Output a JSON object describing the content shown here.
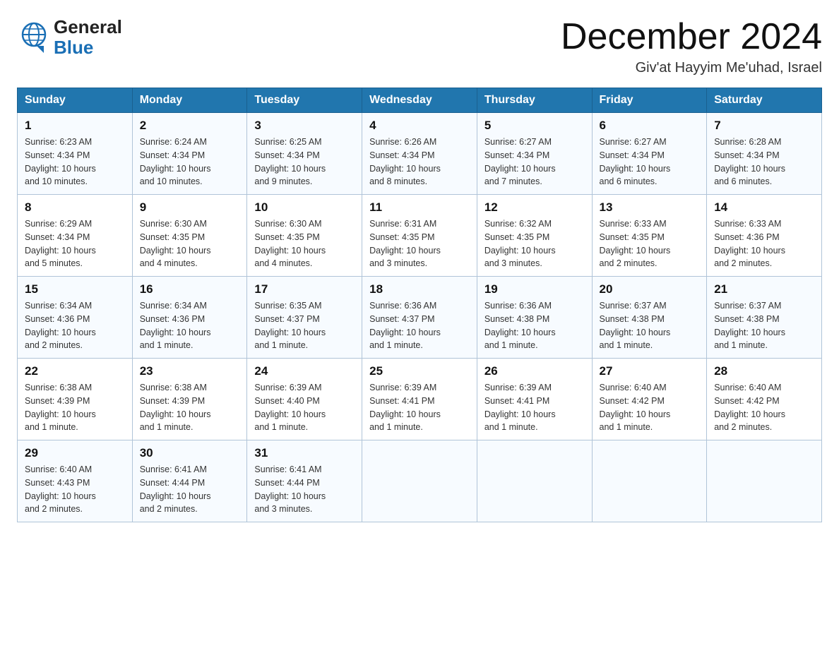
{
  "header": {
    "logo_general": "General",
    "logo_blue": "Blue",
    "month_title": "December 2024",
    "location": "Giv'at Hayyim Me'uhad, Israel"
  },
  "days_of_week": [
    "Sunday",
    "Monday",
    "Tuesday",
    "Wednesday",
    "Thursday",
    "Friday",
    "Saturday"
  ],
  "weeks": [
    [
      {
        "day": "1",
        "sunrise": "6:23 AM",
        "sunset": "4:34 PM",
        "daylight": "10 hours and 10 minutes."
      },
      {
        "day": "2",
        "sunrise": "6:24 AM",
        "sunset": "4:34 PM",
        "daylight": "10 hours and 10 minutes."
      },
      {
        "day": "3",
        "sunrise": "6:25 AM",
        "sunset": "4:34 PM",
        "daylight": "10 hours and 9 minutes."
      },
      {
        "day": "4",
        "sunrise": "6:26 AM",
        "sunset": "4:34 PM",
        "daylight": "10 hours and 8 minutes."
      },
      {
        "day": "5",
        "sunrise": "6:27 AM",
        "sunset": "4:34 PM",
        "daylight": "10 hours and 7 minutes."
      },
      {
        "day": "6",
        "sunrise": "6:27 AM",
        "sunset": "4:34 PM",
        "daylight": "10 hours and 6 minutes."
      },
      {
        "day": "7",
        "sunrise": "6:28 AM",
        "sunset": "4:34 PM",
        "daylight": "10 hours and 6 minutes."
      }
    ],
    [
      {
        "day": "8",
        "sunrise": "6:29 AM",
        "sunset": "4:34 PM",
        "daylight": "10 hours and 5 minutes."
      },
      {
        "day": "9",
        "sunrise": "6:30 AM",
        "sunset": "4:35 PM",
        "daylight": "10 hours and 4 minutes."
      },
      {
        "day": "10",
        "sunrise": "6:30 AM",
        "sunset": "4:35 PM",
        "daylight": "10 hours and 4 minutes."
      },
      {
        "day": "11",
        "sunrise": "6:31 AM",
        "sunset": "4:35 PM",
        "daylight": "10 hours and 3 minutes."
      },
      {
        "day": "12",
        "sunrise": "6:32 AM",
        "sunset": "4:35 PM",
        "daylight": "10 hours and 3 minutes."
      },
      {
        "day": "13",
        "sunrise": "6:33 AM",
        "sunset": "4:35 PM",
        "daylight": "10 hours and 2 minutes."
      },
      {
        "day": "14",
        "sunrise": "6:33 AM",
        "sunset": "4:36 PM",
        "daylight": "10 hours and 2 minutes."
      }
    ],
    [
      {
        "day": "15",
        "sunrise": "6:34 AM",
        "sunset": "4:36 PM",
        "daylight": "10 hours and 2 minutes."
      },
      {
        "day": "16",
        "sunrise": "6:34 AM",
        "sunset": "4:36 PM",
        "daylight": "10 hours and 1 minute."
      },
      {
        "day": "17",
        "sunrise": "6:35 AM",
        "sunset": "4:37 PM",
        "daylight": "10 hours and 1 minute."
      },
      {
        "day": "18",
        "sunrise": "6:36 AM",
        "sunset": "4:37 PM",
        "daylight": "10 hours and 1 minute."
      },
      {
        "day": "19",
        "sunrise": "6:36 AM",
        "sunset": "4:38 PM",
        "daylight": "10 hours and 1 minute."
      },
      {
        "day": "20",
        "sunrise": "6:37 AM",
        "sunset": "4:38 PM",
        "daylight": "10 hours and 1 minute."
      },
      {
        "day": "21",
        "sunrise": "6:37 AM",
        "sunset": "4:38 PM",
        "daylight": "10 hours and 1 minute."
      }
    ],
    [
      {
        "day": "22",
        "sunrise": "6:38 AM",
        "sunset": "4:39 PM",
        "daylight": "10 hours and 1 minute."
      },
      {
        "day": "23",
        "sunrise": "6:38 AM",
        "sunset": "4:39 PM",
        "daylight": "10 hours and 1 minute."
      },
      {
        "day": "24",
        "sunrise": "6:39 AM",
        "sunset": "4:40 PM",
        "daylight": "10 hours and 1 minute."
      },
      {
        "day": "25",
        "sunrise": "6:39 AM",
        "sunset": "4:41 PM",
        "daylight": "10 hours and 1 minute."
      },
      {
        "day": "26",
        "sunrise": "6:39 AM",
        "sunset": "4:41 PM",
        "daylight": "10 hours and 1 minute."
      },
      {
        "day": "27",
        "sunrise": "6:40 AM",
        "sunset": "4:42 PM",
        "daylight": "10 hours and 1 minute."
      },
      {
        "day": "28",
        "sunrise": "6:40 AM",
        "sunset": "4:42 PM",
        "daylight": "10 hours and 2 minutes."
      }
    ],
    [
      {
        "day": "29",
        "sunrise": "6:40 AM",
        "sunset": "4:43 PM",
        "daylight": "10 hours and 2 minutes."
      },
      {
        "day": "30",
        "sunrise": "6:41 AM",
        "sunset": "4:44 PM",
        "daylight": "10 hours and 2 minutes."
      },
      {
        "day": "31",
        "sunrise": "6:41 AM",
        "sunset": "4:44 PM",
        "daylight": "10 hours and 3 minutes."
      },
      null,
      null,
      null,
      null
    ]
  ],
  "labels": {
    "sunrise": "Sunrise:",
    "sunset": "Sunset:",
    "daylight": "Daylight:"
  }
}
